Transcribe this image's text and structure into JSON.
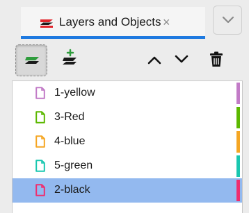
{
  "tab": {
    "label": "Layers and Objects",
    "close_symbol": "×",
    "icon": "layers-stack-icon",
    "accent_color": "#1f7ae0"
  },
  "tab_menu": {
    "icon": "chevron-down-icon"
  },
  "toolbar": {
    "buttons": [
      {
        "name": "layers-view",
        "icon": "layers-icon",
        "active": true
      },
      {
        "name": "add-layer",
        "icon": "add-layer-icon"
      },
      {
        "name": "move-up",
        "icon": "chevron-up-icon"
      },
      {
        "name": "move-down",
        "icon": "chevron-down-icon"
      },
      {
        "name": "delete",
        "icon": "trash-icon"
      }
    ]
  },
  "layers": [
    {
      "label": "1-yellow",
      "color": "#c27bc7",
      "selected": false
    },
    {
      "label": "3-Red",
      "color": "#5cb800",
      "selected": false
    },
    {
      "label": "4-blue",
      "color": "#f5a623",
      "selected": false
    },
    {
      "label": "5-green",
      "color": "#19c7b0",
      "selected": false
    },
    {
      "label": "2-black",
      "color": "#ef2d6e",
      "selected": true
    }
  ]
}
